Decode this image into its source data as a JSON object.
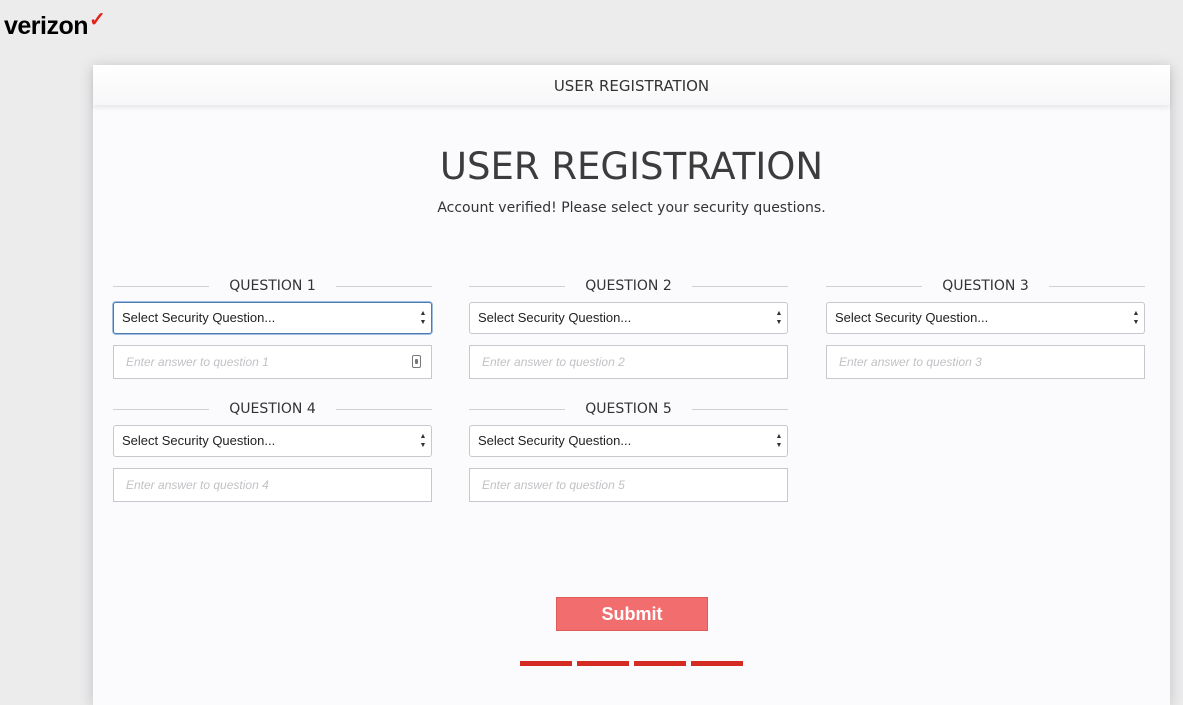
{
  "brand": {
    "name": "verizon",
    "mark": "✓",
    "accent": "#e2231a"
  },
  "panel": {
    "header": "USER REGISTRATION",
    "title": "USER REGISTRATION",
    "subtitle": "Account verified! Please select your security questions."
  },
  "questions": [
    {
      "label": "QUESTION 1",
      "select": "Select Security Question...",
      "placeholder": "Enter answer to question 1"
    },
    {
      "label": "QUESTION 2",
      "select": "Select Security Question...",
      "placeholder": "Enter answer to question 2"
    },
    {
      "label": "QUESTION 3",
      "select": "Select Security Question...",
      "placeholder": "Enter answer to question 3"
    },
    {
      "label": "QUESTION 4",
      "select": "Select Security Question...",
      "placeholder": "Enter answer to question 4"
    },
    {
      "label": "QUESTION 5",
      "select": "Select Security Question...",
      "placeholder": "Enter answer to question 5"
    }
  ],
  "submit": {
    "label": "Submit",
    "color": "#f26d6d"
  },
  "progress": {
    "steps": 4,
    "color": "#d42c22"
  }
}
